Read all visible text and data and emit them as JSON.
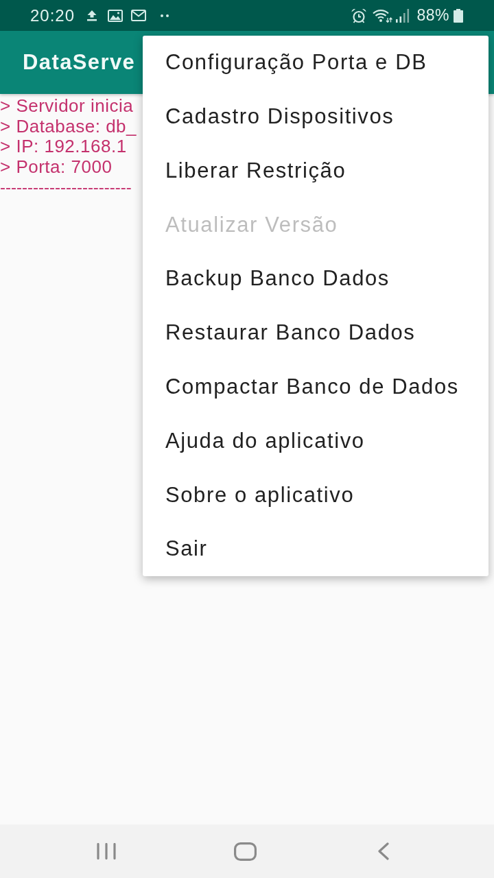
{
  "status_bar": {
    "time": "20:20",
    "battery_percent": "88%"
  },
  "app_bar": {
    "title": "DataServe"
  },
  "log": {
    "lines": [
      "> Servidor inicia",
      "> Database: db_",
      "> IP: 192.168.1",
      "> Porta: 7000"
    ],
    "separator": "------------------------"
  },
  "menu": {
    "items": [
      {
        "label": "Configuração Porta e DB",
        "disabled": false
      },
      {
        "label": "Cadastro Dispositivos",
        "disabled": false
      },
      {
        "label": "Liberar Restrição",
        "disabled": false
      },
      {
        "label": "Atualizar Versão",
        "disabled": true
      },
      {
        "label": "Backup Banco Dados",
        "disabled": false
      },
      {
        "label": "Restaurar Banco Dados",
        "disabled": false
      },
      {
        "label": "Compactar Banco de Dados",
        "disabled": false
      },
      {
        "label": "Ajuda do aplicativo",
        "disabled": false
      },
      {
        "label": "Sobre o aplicativo",
        "disabled": false
      },
      {
        "label": "Sair",
        "disabled": false
      }
    ]
  }
}
